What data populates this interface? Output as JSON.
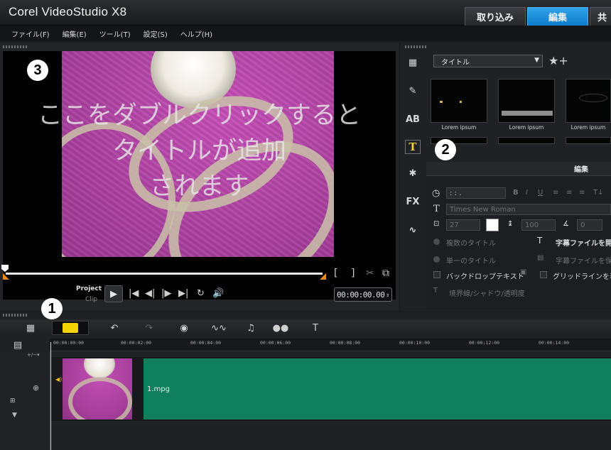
{
  "app": {
    "title": "Corel VideoStudio X8"
  },
  "step_tabs": {
    "capture": "取り込み",
    "edit": "編集",
    "share": "共"
  },
  "menu": {
    "items": [
      "ファイル(F)",
      "編集(E)",
      "ツール(T)",
      "設定(S)",
      "ヘルプ(H)"
    ]
  },
  "preview": {
    "overlay_lines": [
      "ここをダブルクリックすると",
      "タイトルが追加",
      "されます"
    ],
    "project_label": "Project",
    "clip_label": "Clip",
    "timecode": "00:00:00.00"
  },
  "badges": {
    "one": "1",
    "two": "2",
    "three": "3"
  },
  "library": {
    "category": "タイトル",
    "thumbnails": [
      "Lorem ipsum",
      "Lorem ipsum",
      "Lorem ipsum"
    ],
    "edit_tab": "編集",
    "timecode_field": ": : .",
    "font": "Times New Roman",
    "font_size": "27",
    "line_spacing": "100",
    "angle": "0",
    "multi_title": "複数のタイトル",
    "single_title": "単一のタイトル",
    "open_subtitle": "字幕ファイルを開く",
    "save_subtitle": "字幕ファイルを保存",
    "backdrop_text": "バックドロップテキスト",
    "show_grid": "グリッドラインを表示",
    "border_shadow": "境界線/シャドウ/透明度"
  },
  "timeline": {
    "ruler_labels": [
      "00:00:00:00",
      "00:00:02:00",
      "00:00:04:00",
      "00:00:06:00",
      "00:00:08:00",
      "00:00:10:00",
      "00:00:12:00",
      "00:00:14:00"
    ],
    "clip_name": "1.mpg"
  },
  "colors": {
    "accent": "#0f7ccc",
    "clip": "#0f7f5e",
    "highlight": "#f2d400"
  }
}
